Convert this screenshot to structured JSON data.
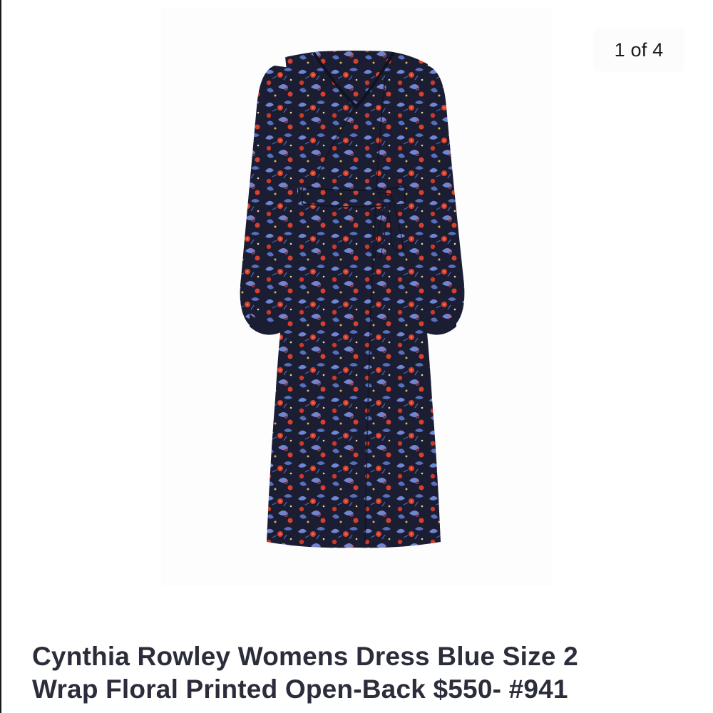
{
  "gallery": {
    "counter": "1 of 4",
    "image_icon": "dress-photo"
  },
  "listing": {
    "title_line1": "Cynthia Rowley Womens Dress Blue Size 2",
    "title_line2": "Wrap Floral Printed Open-Back $550- #941"
  },
  "colors": {
    "background": "#ffffff",
    "dress_base": "#1b1d33",
    "print_blue": "#6f86d4",
    "print_red": "#d8402d",
    "print_gold": "#d9b44a",
    "title_text": "#2b2e3a"
  }
}
